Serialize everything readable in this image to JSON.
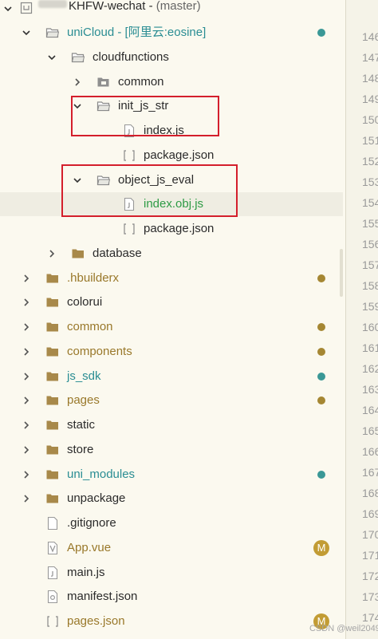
{
  "project": {
    "name": "KHFW-wechat",
    "branch": "(master)"
  },
  "tree": [
    {
      "label": "uniCloud",
      "suffix": " - [阿里云:eosine]",
      "depth": 1,
      "type": "folder",
      "expanded": true,
      "color": "teal",
      "status": "dot-teal",
      "name": "unicloud"
    },
    {
      "label": "cloudfunctions",
      "depth": 2,
      "type": "folder",
      "expanded": true,
      "name": "cloudfunctions"
    },
    {
      "label": "common",
      "depth": 3,
      "type": "folder-special",
      "expanded": false,
      "name": "cloud-common"
    },
    {
      "label": "init_js_str",
      "depth": 3,
      "type": "folder",
      "expanded": true,
      "name": "init-js-str"
    },
    {
      "label": "index.js",
      "depth": 4,
      "type": "js",
      "name": "init-index-js"
    },
    {
      "label": "package.json",
      "depth": 4,
      "type": "json",
      "name": "init-package-json"
    },
    {
      "label": "object_js_eval",
      "depth": 3,
      "type": "folder",
      "expanded": true,
      "name": "object-js-eval"
    },
    {
      "label": "index.obj.js",
      "depth": 4,
      "type": "js",
      "color": "green",
      "selected": true,
      "name": "index-obj-js"
    },
    {
      "label": "package.json",
      "depth": 4,
      "type": "json",
      "name": "eval-package-json"
    },
    {
      "label": "database",
      "depth": 2,
      "type": "folder-closed",
      "expanded": false,
      "name": "database"
    },
    {
      "label": ".hbuilderx",
      "depth": 1,
      "type": "folder-closed",
      "expanded": false,
      "color": "olive",
      "status": "dot-olive",
      "name": "hbuilderx"
    },
    {
      "label": "colorui",
      "depth": 1,
      "type": "folder-closed",
      "expanded": false,
      "name": "colorui"
    },
    {
      "label": "common",
      "depth": 1,
      "type": "folder-closed",
      "expanded": false,
      "color": "olive",
      "status": "dot-olive",
      "name": "common"
    },
    {
      "label": "components",
      "depth": 1,
      "type": "folder-closed",
      "expanded": false,
      "color": "olive",
      "status": "dot-olive",
      "name": "components"
    },
    {
      "label": "js_sdk",
      "depth": 1,
      "type": "folder-closed",
      "expanded": false,
      "color": "teal",
      "status": "dot-teal",
      "name": "js-sdk"
    },
    {
      "label": "pages",
      "depth": 1,
      "type": "folder-closed",
      "expanded": false,
      "color": "olive",
      "status": "dot-olive",
      "name": "pages"
    },
    {
      "label": "static",
      "depth": 1,
      "type": "folder-closed",
      "expanded": false,
      "name": "static"
    },
    {
      "label": "store",
      "depth": 1,
      "type": "folder-closed",
      "expanded": false,
      "name": "store"
    },
    {
      "label": "uni_modules",
      "depth": 1,
      "type": "folder-closed",
      "expanded": false,
      "color": "teal",
      "status": "dot-teal",
      "name": "uni-modules"
    },
    {
      "label": "unpackage",
      "depth": 1,
      "type": "folder-closed",
      "expanded": false,
      "name": "unpackage"
    },
    {
      "label": ".gitignore",
      "depth": 1,
      "type": "file",
      "leaf": true,
      "name": "gitignore"
    },
    {
      "label": "App.vue",
      "depth": 1,
      "type": "vue",
      "leaf": true,
      "color": "olive",
      "status": "M",
      "name": "app-vue"
    },
    {
      "label": "main.js",
      "depth": 1,
      "type": "js",
      "leaf": true,
      "name": "main-js"
    },
    {
      "label": "manifest.json",
      "depth": 1,
      "type": "manifest",
      "leaf": true,
      "name": "manifest-json"
    },
    {
      "label": "pages.json",
      "depth": 1,
      "type": "json",
      "leaf": true,
      "color": "olive",
      "status": "M",
      "name": "pages-json"
    }
  ],
  "gutter": [
    "146",
    "147",
    "148",
    "149",
    "150",
    "151",
    "152",
    "153",
    "154",
    "155",
    "156",
    "157",
    "158",
    "159",
    "160",
    "161",
    "162",
    "163",
    "164",
    "165",
    "166",
    "167",
    "168",
    "169",
    "170",
    "171",
    "172",
    "173",
    "174"
  ],
  "watermark": "CSDN @weil2049",
  "colors": {
    "background": "#fbf9ef",
    "teal": "#2a8d93",
    "olive": "#99782a",
    "green": "#2e9b45",
    "highlight_box": "#d41f2c"
  }
}
